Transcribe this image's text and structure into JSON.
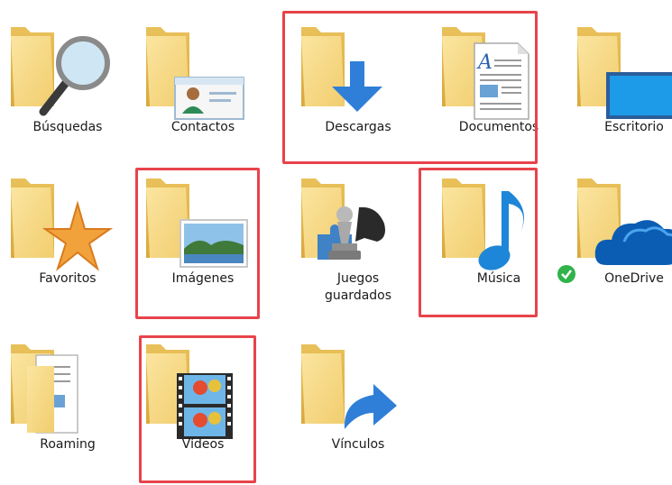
{
  "folders": [
    {
      "label": "Búsquedas",
      "icon": "search-icon"
    },
    {
      "label": "Contactos",
      "icon": "contact-card-icon"
    },
    {
      "label": "Descargas",
      "icon": "download-arrow-icon"
    },
    {
      "label": "Documentos",
      "icon": "document-icon"
    },
    {
      "label": "Escritorio",
      "icon": "desktop-icon"
    },
    {
      "label": "Favoritos",
      "icon": "star-icon"
    },
    {
      "label": "Imágenes",
      "icon": "picture-icon"
    },
    {
      "label": "Juegos\nguardados",
      "icon": "chess-piece-icon"
    },
    {
      "label": "Música",
      "icon": "music-note-icon"
    },
    {
      "label": "OneDrive",
      "icon": "cloud-icon"
    },
    {
      "label": "Roaming",
      "icon": "folder-files-icon"
    },
    {
      "label": "Vídeos",
      "icon": "film-strip-icon"
    },
    {
      "label": "Vínculos",
      "icon": "shortcut-arrow-icon"
    }
  ],
  "highlight_color": "#e8434b",
  "folder_color": "#f3d27a"
}
